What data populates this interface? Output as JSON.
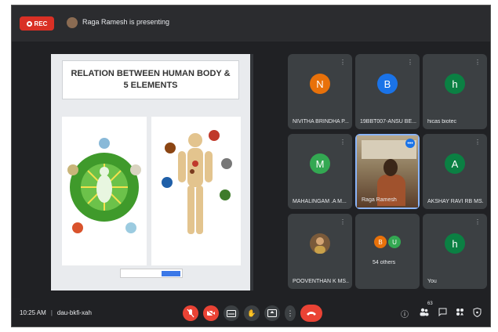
{
  "topbar": {
    "rec_label": "REC",
    "presenting_text": "Raga Ramesh is presenting"
  },
  "slide": {
    "title": "RELATION BETWEEN HUMAN BODY & 5 ELEMENTS"
  },
  "participants": [
    {
      "initial": "N",
      "name": "NIVITHA BRINDHA P...",
      "color": "#e8710a"
    },
    {
      "initial": "B",
      "name": "19BBT007-ANSU BE...",
      "color": "#1a73e8"
    },
    {
      "initial": "h",
      "name": "hicas biotec",
      "color": "#0b8043"
    },
    {
      "initial": "M",
      "name": "MAHALINGAM .A M...",
      "color": "#33a852"
    },
    {
      "initial": "",
      "name": "Raga Ramesh",
      "color": "#5a4a3a"
    },
    {
      "initial": "A",
      "name": "AKSHAY RAVI RB MS...",
      "color": "#0b8043"
    },
    {
      "initial": "",
      "name": "POOVENTHAN K MS...",
      "color": "#7a5a3a"
    },
    {
      "initial": "",
      "name": "54 others",
      "color": ""
    },
    {
      "initial": "h",
      "name": "You",
      "color": "#0b8043"
    }
  ],
  "others_avatars": [
    {
      "initial": "B",
      "color": "#e8710a"
    },
    {
      "initial": "U",
      "color": "#33a852"
    }
  ],
  "bottombar": {
    "time": "10:25 AM",
    "separator": "|",
    "meeting_code": "dau-bkfi-xah",
    "participants_count": "63"
  },
  "colors": {
    "accent": "#1a73e8",
    "danger": "#ea4335",
    "background": "#202124",
    "tile": "#3c4043"
  }
}
